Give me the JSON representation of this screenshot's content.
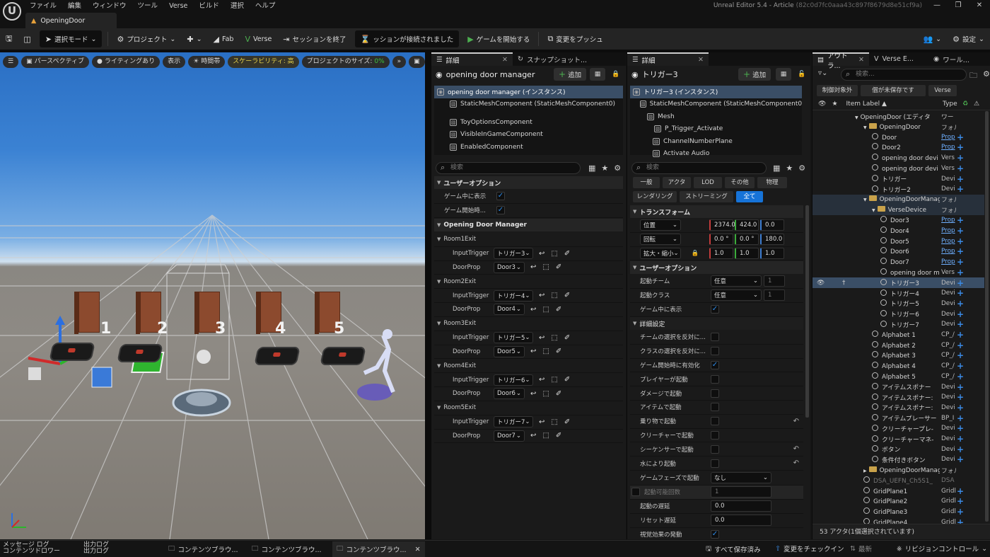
{
  "app": {
    "menus": [
      "ファイル",
      "編集",
      "ウィンドウ",
      "ツール",
      "Verse",
      "ビルド",
      "選択",
      "ヘルプ"
    ],
    "title": "Unreal Editor 5.4 - Article",
    "title_hash": "(82c0d7fc0aaa43c897f8679d8e51cf9a)",
    "doc_tab": "OpeningDoor"
  },
  "toolbar": {
    "mode": "選択モード",
    "project": "プロジェクト",
    "fab": "Fab",
    "verse": "Verse",
    "end_session": "セッションを終了",
    "session_status": "ッションが接続されました",
    "start_game": "ゲームを開始する",
    "push_changes": "変更をプッシュ",
    "settings": "設定"
  },
  "viewport": {
    "perspective": "パースペクティブ",
    "lighting": "ライティングあり",
    "show": "表示",
    "time": "時間帯",
    "scalability": "スケーラビリティ: 高",
    "project_size": "プロジェクトのサイズ:",
    "project_size_value": "0%",
    "door_numbers": [
      "1",
      "2",
      "3",
      "4",
      "5"
    ]
  },
  "details1": {
    "tab1": "詳細",
    "tab2": "スナップショット...",
    "title": "opening door manager",
    "add": "追加",
    "components": [
      "opening door manager (インスタンス)",
      "StaticMeshComponent (StaticMeshComponent0)",
      "ToyOptionsComponent",
      "VisibleInGameComponent",
      "EnabledComponent"
    ],
    "search_placeholder": "検索",
    "user_options": "ユーザーオプション",
    "show_in_game": "ゲーム中に表示",
    "enable_on_start": "ゲーム開始時...",
    "manager_section": "Opening Door Manager",
    "rooms": [
      {
        "name": "Room1Exit",
        "trigger": "トリガー3",
        "door": "Door3"
      },
      {
        "name": "Room2Exit",
        "trigger": "トリガー4",
        "door": "Door4"
      },
      {
        "name": "Room3Exit",
        "trigger": "トリガー5",
        "door": "Door5"
      },
      {
        "name": "Room4Exit",
        "trigger": "トリガー6",
        "door": "Door6"
      },
      {
        "name": "Room5Exit",
        "trigger": "トリガー7",
        "door": "Door7"
      }
    ],
    "input_trigger": "InputTrigger",
    "door_prop": "DoorProp"
  },
  "details2": {
    "tab": "詳細",
    "title": "トリガー3",
    "add": "追加",
    "components": [
      "トリガー3 (インスタンス)",
      "StaticMeshComponent (StaticMeshComponent0",
      "Mesh",
      "P_Trigger_Activate",
      "ChannelNumberPlane",
      "Activate Audio"
    ],
    "search_placeholder": "検索",
    "filters": [
      "一般",
      "アクタ",
      "LOD",
      "その他",
      "物理",
      "レンダリング",
      "ストリーミング",
      "全て"
    ],
    "transform": "トランスフォーム",
    "location": "位置",
    "location_values": [
      "2374.0",
      "424.0",
      "0.0"
    ],
    "rotation": "回転",
    "rotation_values": [
      "0.0 °",
      "0.0 °",
      "180.0"
    ],
    "scale": "拡大・縮小",
    "scale_values": [
      "1.0",
      "1.0",
      "1.0"
    ],
    "user_options": "ユーザーオプション",
    "activating_team": "起動チーム",
    "activating_team_value": "任意",
    "activating_team_num": "1",
    "activating_class": "起動クラス",
    "activating_class_value": "任意",
    "activating_class_num": "1",
    "visible_in_game": "ゲーム中に表示",
    "advanced": "詳細設定",
    "rows": [
      {
        "label": "チームの選択を反対に...",
        "checked": false
      },
      {
        "label": "クラスの選択を反対に...",
        "checked": false
      },
      {
        "label": "ゲーム開始時に有効化",
        "checked": true
      },
      {
        "label": "プレイヤーが起動",
        "checked": false
      },
      {
        "label": "ダメージで起動",
        "checked": false
      },
      {
        "label": "アイテムで起動",
        "checked": false
      },
      {
        "label": "乗り物で起動",
        "checked": false
      },
      {
        "label": "クリーチャーで起動",
        "checked": false
      },
      {
        "label": "シーケンサーで起動",
        "checked": false
      },
      {
        "label": "水により起動",
        "checked": false
      }
    ],
    "game_phase": "ゲームフェーズで起動",
    "game_phase_value": "なし",
    "activation_count": "起動可能回数",
    "activation_count_value": "1",
    "delay": "起動の遅延",
    "delay_value": "0.0",
    "reset_delay": "リセット遅延",
    "reset_delay_value": "0.0",
    "visual_effects": "視覚効果の発動"
  },
  "outliner": {
    "tab1": "アウトラ...",
    "tab2": "Verse E...",
    "tab3": "ワール...",
    "search_placeholder": "検索...",
    "filter1": "制御対象外",
    "filter2": "個が未保存です",
    "filter3": "Verse",
    "col_label": "Item Label ▲",
    "col_type": "Type",
    "rows": [
      {
        "label": "OpeningDoor (エディタ",
        "type": "ワー",
        "indent": 0,
        "kind": "world"
      },
      {
        "label": "OpeningDoor",
        "type": "フォル",
        "indent": 1,
        "kind": "folder"
      },
      {
        "label": "Door",
        "type": "Prop",
        "indent": 2,
        "kind": "actor",
        "link": true
      },
      {
        "label": "Door2",
        "type": "Prop",
        "indent": 2,
        "kind": "actor",
        "link": true
      },
      {
        "label": "opening door devi",
        "type": "Vers",
        "indent": 2,
        "kind": "actor"
      },
      {
        "label": "opening door devi",
        "type": "Vers",
        "indent": 2,
        "kind": "actor"
      },
      {
        "label": "トリガー",
        "type": "Devi",
        "indent": 2,
        "kind": "actor"
      },
      {
        "label": "トリガー2",
        "type": "Devi",
        "indent": 2,
        "kind": "actor"
      },
      {
        "label": "OpeningDoorManag",
        "type": "フォル",
        "indent": 1,
        "kind": "folder"
      },
      {
        "label": "VerseDevice",
        "type": "フォル",
        "indent": 2,
        "kind": "folder"
      },
      {
        "label": "Door3",
        "type": "Prop",
        "indent": 3,
        "kind": "actor",
        "link": true
      },
      {
        "label": "Door4",
        "type": "Prop",
        "indent": 3,
        "kind": "actor",
        "link": true
      },
      {
        "label": "Door5",
        "type": "Prop",
        "indent": 3,
        "kind": "actor",
        "link": true
      },
      {
        "label": "Door6",
        "type": "Prop",
        "indent": 3,
        "kind": "actor",
        "link": true
      },
      {
        "label": "Door7",
        "type": "Prop",
        "indent": 3,
        "kind": "actor",
        "link": true
      },
      {
        "label": "opening door m",
        "type": "Vers",
        "indent": 3,
        "kind": "actor"
      },
      {
        "label": "トリガー3",
        "type": "Devi",
        "indent": 3,
        "kind": "actor",
        "selected": true
      },
      {
        "label": "トリガー4",
        "type": "Devi",
        "indent": 3,
        "kind": "actor"
      },
      {
        "label": "トリガー5",
        "type": "Devi",
        "indent": 3,
        "kind": "actor"
      },
      {
        "label": "トリガー6",
        "type": "Devi",
        "indent": 3,
        "kind": "actor"
      },
      {
        "label": "トリガー7",
        "type": "Devi",
        "indent": 3,
        "kind": "actor"
      },
      {
        "label": "Alphabet 1",
        "type": "CP_/",
        "indent": 2,
        "kind": "actor"
      },
      {
        "label": "Alphabet 2",
        "type": "CP_/",
        "indent": 2,
        "kind": "actor"
      },
      {
        "label": "Alphabet 3",
        "type": "CP_/",
        "indent": 2,
        "kind": "actor"
      },
      {
        "label": "Alphabet 4",
        "type": "CP_/",
        "indent": 2,
        "kind": "actor"
      },
      {
        "label": "Alphabet 5",
        "type": "CP_/",
        "indent": 2,
        "kind": "actor"
      },
      {
        "label": "アイテムスポナー",
        "type": "Devi",
        "indent": 2,
        "kind": "actor"
      },
      {
        "label": "アイテムスポナー:",
        "type": "Devi",
        "indent": 2,
        "kind": "actor"
      },
      {
        "label": "アイテムスポナー:",
        "type": "Devi",
        "indent": 2,
        "kind": "actor"
      },
      {
        "label": "アイテムプレーサー",
        "type": "BP_I",
        "indent": 2,
        "kind": "actor"
      },
      {
        "label": "クリーチャープレ-",
        "type": "Devi",
        "indent": 2,
        "kind": "actor"
      },
      {
        "label": "クリーチャーマネ-",
        "type": "Devi",
        "indent": 2,
        "kind": "actor"
      },
      {
        "label": "ボタン",
        "type": "Devi",
        "indent": 2,
        "kind": "actor"
      },
      {
        "label": "条件付きボタン",
        "type": "Devi",
        "indent": 2,
        "kind": "actor"
      },
      {
        "label": "OpeningDoorManag",
        "type": "フォル",
        "indent": 1,
        "kind": "folder",
        "collapsed": true
      },
      {
        "label": "DSA_UEFN_Ch5S1_",
        "type": "DSA",
        "indent": 1,
        "kind": "actor",
        "dim": true
      },
      {
        "label": "GridPlane1",
        "type": "Gridl",
        "indent": 1,
        "kind": "actor"
      },
      {
        "label": "GridPlane2",
        "type": "Gridl",
        "indent": 1,
        "kind": "actor"
      },
      {
        "label": "GridPlane3",
        "type": "Gridl",
        "indent": 1,
        "kind": "actor"
      },
      {
        "label": "GridPlane4",
        "type": "Gridl",
        "indent": 1,
        "kind": "actor"
      }
    ],
    "status": "53 アクタ(1個選択されています)"
  },
  "bottom": {
    "message_log": "メッセージ ログ",
    "content_drawer": "コンテンツドロワー",
    "output_log": "出力ログ",
    "output_log2": "出力ログ",
    "content_browsers": [
      "コンテンツブラウ...",
      "コンテンツブラウ...",
      "コンテンツブラウ..."
    ],
    "save_all": "すべて保存済み",
    "check_in": "変更をチェックイン",
    "latest": "最新",
    "revision": "リビジョンコントロール"
  }
}
